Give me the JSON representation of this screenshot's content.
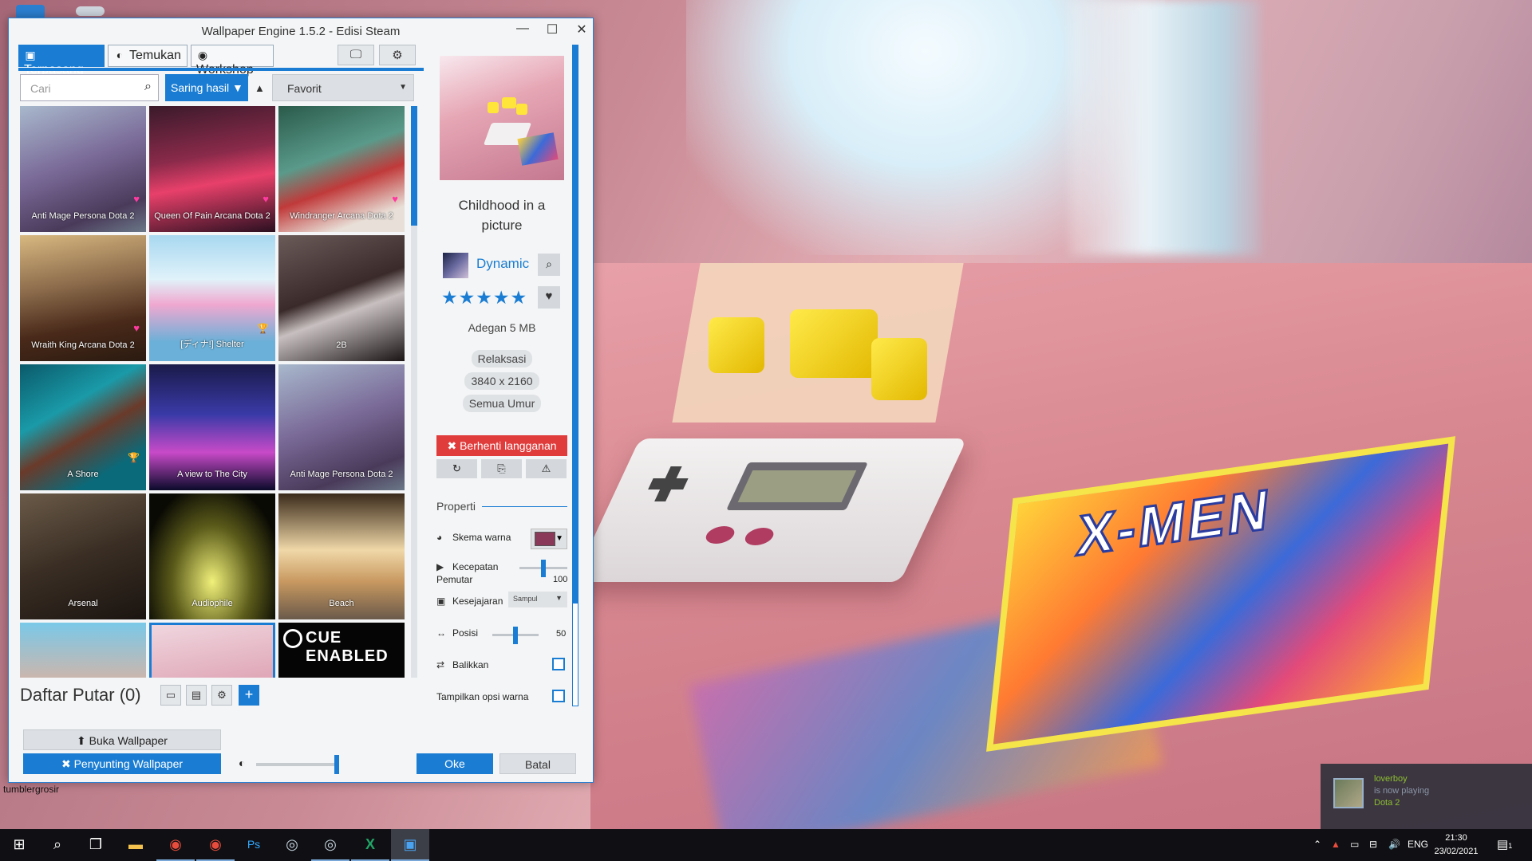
{
  "window": {
    "title": "Wallpaper Engine 1.5.2 - Edisi Steam",
    "min_glyph": "—",
    "max_glyph": "☐",
    "close_glyph": "✕"
  },
  "tabs": [
    {
      "label": "Terpasang",
      "icon": "floppy-icon",
      "glyph": "▣"
    },
    {
      "label": "Temukan",
      "icon": "compass-icon",
      "glyph": "◐"
    },
    {
      "label": "Workshop",
      "icon": "steam-icon",
      "glyph": "◉"
    }
  ],
  "toolbar": {
    "monitor_glyph": "🖵",
    "gear_glyph": "⚙"
  },
  "search": {
    "placeholder": "Cari",
    "icon_glyph": "⌕"
  },
  "filter": {
    "label": "Saring hasil",
    "icon_glyph": "▼"
  },
  "sort": {
    "direction_glyph": "▲",
    "selected": "Favorit",
    "caret": "▼"
  },
  "wallpapers": [
    {
      "title": "Anti Mage Persona Dota 2",
      "badge": "♥"
    },
    {
      "title": "Queen Of Pain Arcana Dota 2",
      "badge": "♥"
    },
    {
      "title": "Windranger Arcana Dota 2",
      "badge": "♥"
    },
    {
      "title": "Wraith King Arcana Dota 2",
      "badge": "♥"
    },
    {
      "title": "[ディナ!] Shelter",
      "badge": "🏆"
    },
    {
      "title": "2B",
      "badge": ""
    },
    {
      "title": "A Shore",
      "badge": "🏆"
    },
    {
      "title": "A view to The City",
      "badge": ""
    },
    {
      "title": "Anti Mage Persona Dota 2",
      "badge": ""
    },
    {
      "title": "Arsenal",
      "badge": ""
    },
    {
      "title": "Audiophile",
      "badge": ""
    },
    {
      "title": "Beach",
      "badge": ""
    },
    {
      "title": "",
      "badge": ""
    },
    {
      "title": "",
      "badge": ""
    },
    {
      "title": "CUE ENABLED",
      "badge": ""
    }
  ],
  "playlist": {
    "label": "Daftar Putar (0)",
    "open_glyph": "▭",
    "save_glyph": "▤",
    "settings_glyph": "⚙",
    "add_glyph": "+"
  },
  "buttons": {
    "open_wallpaper": "⬆ Buka Wallpaper",
    "editor": "✖ Penyunting Wallpaper",
    "ok": "Oke",
    "cancel": "Batal",
    "brightness_glyph": "◐"
  },
  "details": {
    "title": "Childhood in a picture",
    "author": "Dynamic",
    "search_glyph": "⌕",
    "rating_stars": "★★★★★",
    "rating": 5,
    "fav_glyph": "♥",
    "meta": "Adegan  5 MB",
    "tags": [
      "Relaksasi",
      "3840 x 2160",
      "Semua Umur"
    ],
    "unsubscribe": "✖ Berhenti langganan",
    "action_glyphs": [
      "↻",
      "⎘",
      "⚠"
    ]
  },
  "properties": {
    "header": "Properti",
    "scheme": {
      "label": "Skema warna",
      "glyph": "◕",
      "color": "#8a3a58",
      "caret": "▼"
    },
    "speed": {
      "label1": "Kecepatan",
      "label2": "Pemutar",
      "glyph": "▶",
      "value": "100",
      "level": 0.5
    },
    "alignment": {
      "label": "Kesejajaran",
      "glyph": "▣",
      "selected": "Sampul",
      "caret": "▼"
    },
    "position": {
      "label": "Posisi",
      "glyph": "↔",
      "value": "50",
      "level": 0.5
    },
    "flip": {
      "label": "Balikkan",
      "glyph": "⇄",
      "checked": false
    },
    "show_color": {
      "label": "Tampilkan opsi warna",
      "checked": false
    }
  },
  "desktop": {
    "icon_label": "tumblergrosir",
    "comic_text": "X-MEN"
  },
  "notification": {
    "user": "loverboy",
    "status": "is now playing",
    "game": "Dota 2"
  },
  "taskbar": {
    "start_glyph": "⊞",
    "search_glyph": "⌕",
    "taskview_glyph": "❐",
    "apps": [
      {
        "name": "file-explorer-icon",
        "glyph": "▬",
        "color": "#f2c14e"
      },
      {
        "name": "chrome-icon",
        "glyph": "◉",
        "color": "#e84c3d"
      },
      {
        "name": "chrome-icon",
        "glyph": "◉",
        "color": "#e84c3d"
      },
      {
        "name": "photoshop-icon",
        "glyph": "Ps",
        "color": "#31a8ff"
      },
      {
        "name": "steam-icon",
        "glyph": "◎",
        "color": "#c7d5e0"
      },
      {
        "name": "steam-icon",
        "glyph": "◎",
        "color": "#c7d5e0"
      },
      {
        "name": "excel-icon",
        "glyph": "X",
        "color": "#21a366"
      },
      {
        "name": "wallpaper-engine-icon",
        "glyph": "▣",
        "color": "#4aa3f0"
      }
    ],
    "tray_arrow": "⌃",
    "tray_glyphs": [
      "▲",
      "▭",
      "⊟",
      "🔊"
    ],
    "language": "ENG",
    "time": "21:30",
    "date": "23/02/2021",
    "notification_count": "1",
    "notification_glyph": "▤"
  }
}
